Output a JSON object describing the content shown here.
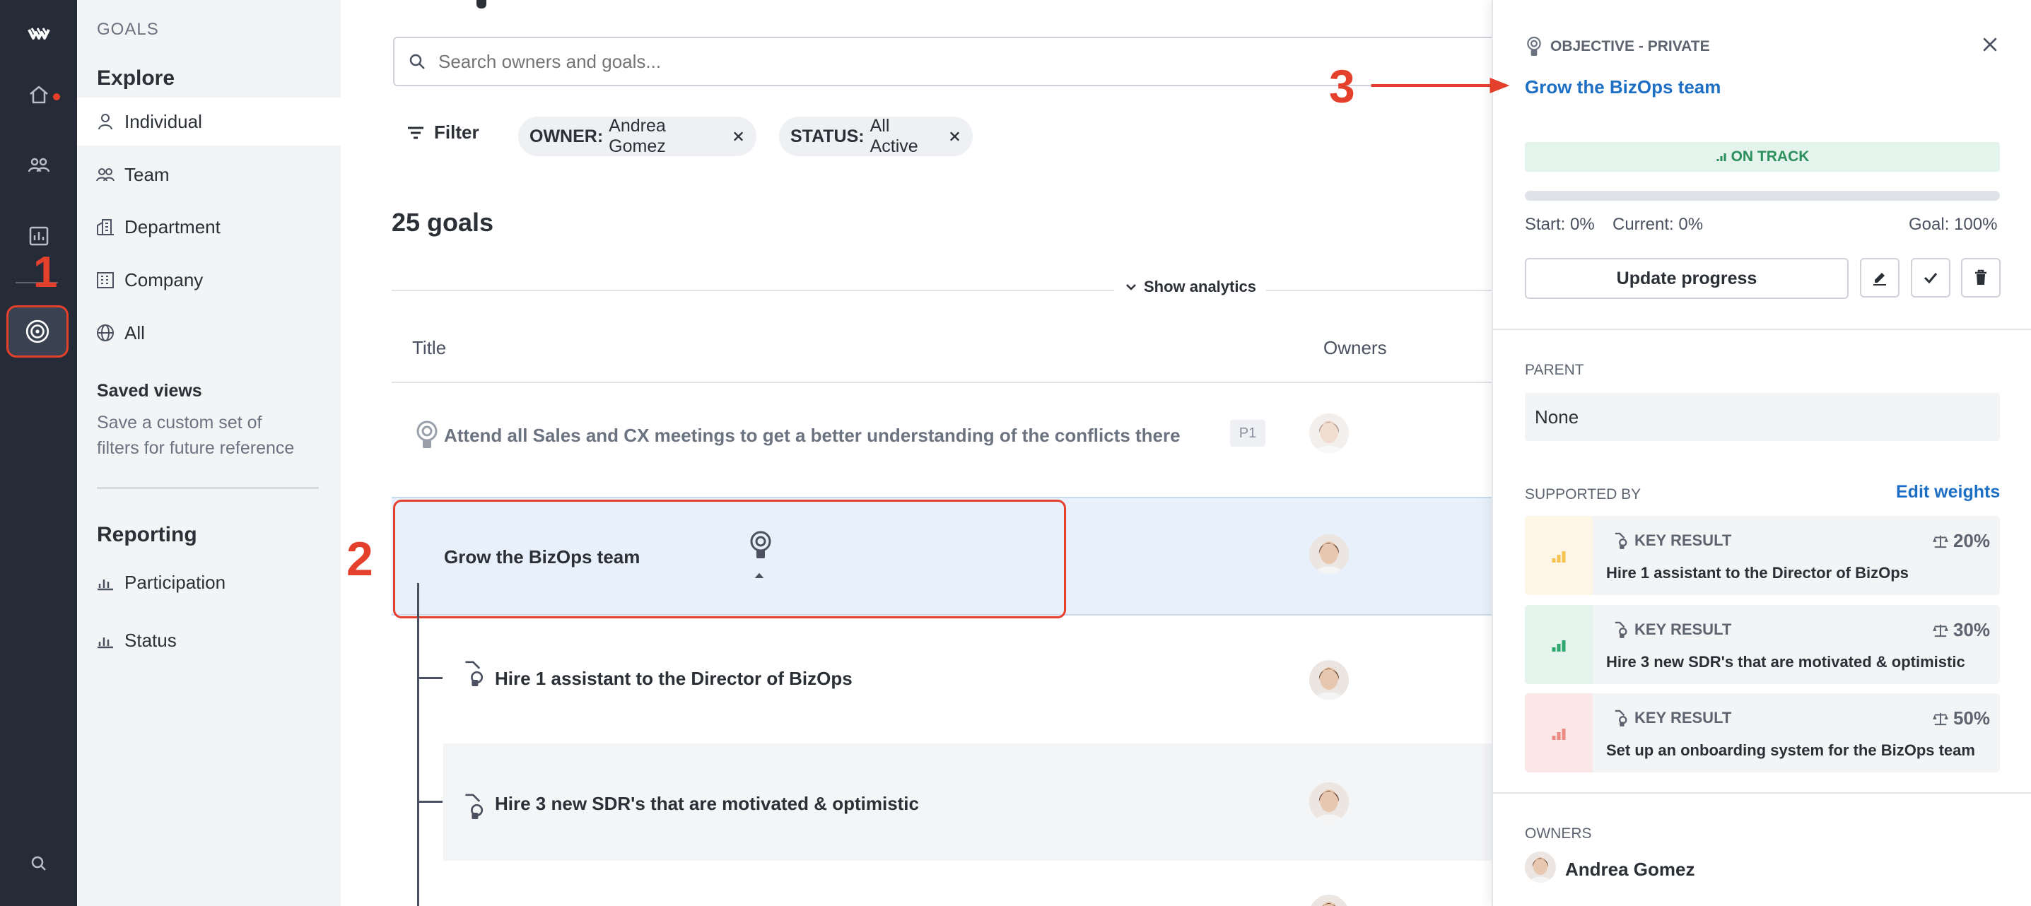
{
  "nav": {
    "section_title": "GOALS",
    "explore_title": "Explore",
    "explore_items": [
      {
        "label": "Individual",
        "icon": "person-icon"
      },
      {
        "label": "Team",
        "icon": "people-icon"
      },
      {
        "label": "Department",
        "icon": "department-icon"
      },
      {
        "label": "Company",
        "icon": "building-icon"
      },
      {
        "label": "All",
        "icon": "globe-icon"
      }
    ],
    "saved_views_title": "Saved views",
    "saved_views_desc_1": "Save a custom set of",
    "saved_views_desc_2": "filters for future reference",
    "reporting_title": "Reporting",
    "reporting_items": [
      {
        "label": "Participation",
        "icon": "bar-chart-icon"
      },
      {
        "label": "Status",
        "icon": "bar-chart-icon"
      }
    ]
  },
  "main": {
    "search_placeholder": "Search owners and goals...",
    "filter_label": "Filter",
    "chips": [
      {
        "key": "OWNER:",
        "value": "Andrea Gomez"
      },
      {
        "key": "STATUS:",
        "value": "All Active"
      }
    ],
    "goal_count": "25 goals",
    "show_analytics": "Show analytics",
    "columns": {
      "title": "Title",
      "owners": "Owners"
    },
    "rows": [
      {
        "title": "Attend all Sales and CX meetings to get a better understanding of the conflicts there",
        "badge": "P1"
      },
      {
        "title": "Grow the BizOps team"
      },
      {
        "title": "Hire 1 assistant to the Director of BizOps"
      },
      {
        "title": "Hire 3 new SDR's that are motivated & optimistic"
      }
    ]
  },
  "panel": {
    "type_label": "OBJECTIVE - PRIVATE",
    "title": "Grow the BizOps team",
    "status": "ON TRACK",
    "progress_fraction": 0,
    "start": "Start: 0%",
    "current": "Current: 0%",
    "goal": "Goal: 100%",
    "update_button": "Update progress",
    "parent_label": "PARENT",
    "parent_value": "None",
    "supported_by_label": "SUPPORTED BY",
    "edit_weights": "Edit weights",
    "key_results": [
      {
        "label": "KEY RESULT",
        "weight": "20%",
        "title": "Hire 1 assistant to the Director of BizOps",
        "color": "#f5c451",
        "bg": "#fdf6e6"
      },
      {
        "label": "KEY RESULT",
        "weight": "30%",
        "title": "Hire 3 new SDR's that are motivated & optimistic",
        "color": "#2fa56f",
        "bg": "#e5f4ec"
      },
      {
        "label": "KEY RESULT",
        "weight": "50%",
        "title": "Set up an onboarding system for the BizOps team",
        "color": "#ee8a84",
        "bg": "#fbe8e6"
      }
    ],
    "owners_label": "OWNERS",
    "owner_name": "Andrea Gomez"
  },
  "annotations": {
    "one": "1",
    "two": "2",
    "three": "3",
    "color": "#e5402b"
  },
  "colors": {
    "accent": "#1d6ec5",
    "rail": "#252b37",
    "on_track_bg": "#e4f3ec",
    "on_track_text": "#2a8f5c"
  }
}
